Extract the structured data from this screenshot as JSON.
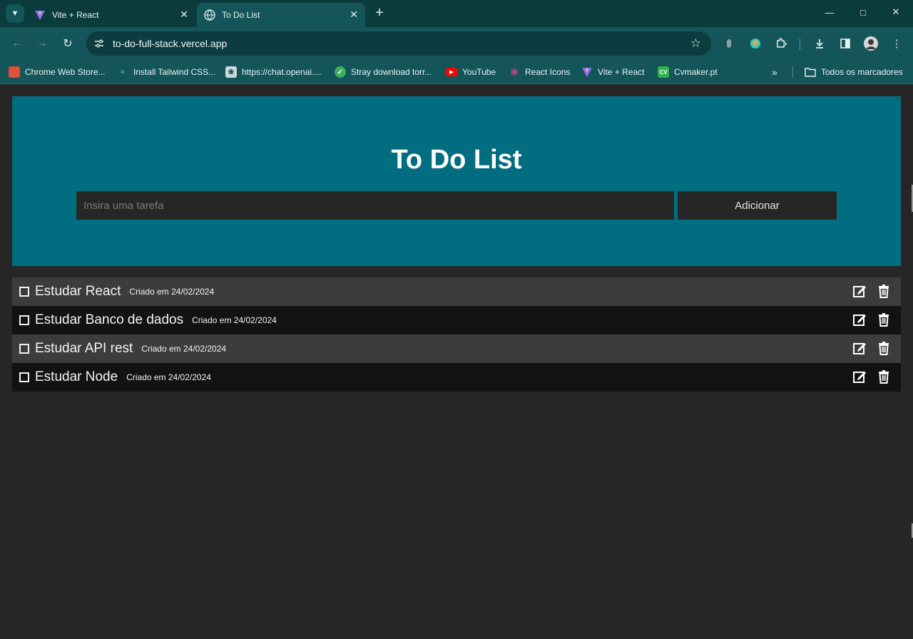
{
  "browser": {
    "tabs": [
      {
        "title": "Vite + React",
        "active": false,
        "favicon": "vite-icon"
      },
      {
        "title": "To Do List",
        "active": true,
        "favicon": "globe-icon"
      }
    ],
    "url": "to-do-full-stack.vercel.app",
    "bookmarks": [
      {
        "label": "Chrome Web Store...",
        "icon": "chrome-store-icon",
        "color": "#e04f3a"
      },
      {
        "label": "Install Tailwind CSS...",
        "icon": "tailwind-icon",
        "color": "#38bdf8"
      },
      {
        "label": "https://chat.openai....",
        "icon": "openai-icon",
        "color": "#cfd8d8"
      },
      {
        "label": "Stray download torr...",
        "icon": "shield-icon",
        "color": "#3fae5a"
      },
      {
        "label": "YouTube",
        "icon": "youtube-icon",
        "color": "#ff0000"
      },
      {
        "label": "React Icons",
        "icon": "react-icon",
        "color": "#e0457b"
      },
      {
        "label": "Vite + React",
        "icon": "vite-icon",
        "color": "#a96cff"
      },
      {
        "label": "Cvmaker.pt",
        "icon": "cv-icon",
        "color": "#2fb24a"
      }
    ],
    "all_bookmarks_label": "Todos os marcadores"
  },
  "app": {
    "title": "To Do List",
    "input_placeholder": "Insira uma tarefa",
    "add_label": "Adicionar",
    "colors": {
      "header": "#016d80",
      "background": "#262626"
    },
    "tasks": [
      {
        "title": "Estudar React",
        "created": "Criado em 24/02/2024"
      },
      {
        "title": "Estudar Banco de dados",
        "created": "Criado em 24/02/2024"
      },
      {
        "title": "Estudar API rest",
        "created": "Criado em 24/02/2024"
      },
      {
        "title": "Estudar Node",
        "created": "Criado em 24/02/2024"
      }
    ]
  }
}
